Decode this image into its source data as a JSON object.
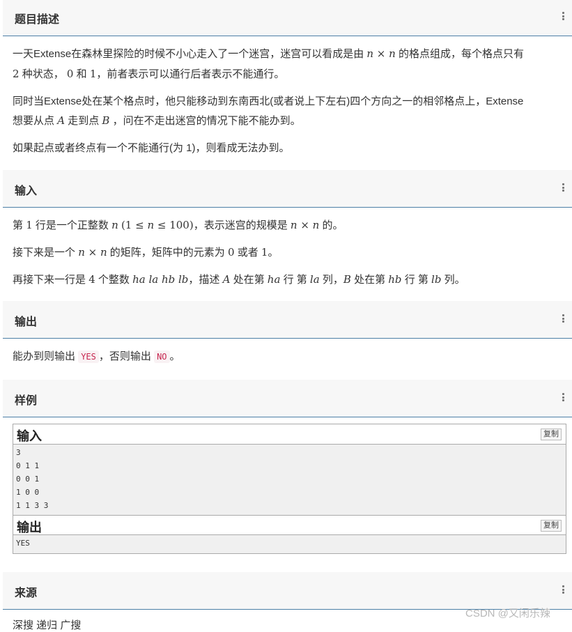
{
  "sections": {
    "description": {
      "title": "题目描述"
    },
    "input": {
      "title": "输入"
    },
    "output": {
      "title": "输出"
    },
    "sample": {
      "title": "样例"
    },
    "source": {
      "title": "来源"
    }
  },
  "description": {
    "p1_l1_a": "一天Extense在森林里探险的时候不小心走入了一个迷宫，迷宫可以看成是由",
    "p1_l1_b": "n × n",
    "p1_l1_c": "的格点组成，每个格点只有",
    "p1_l2_a": "2",
    "p1_l2_b": "种状态，",
    "p1_l2_c": "0",
    "p1_l2_d": "和",
    "p1_l2_e": "1",
    "p1_l2_f": "，前者表示可以通行后者表示不能通行。",
    "p2_l1": "同时当Extense处在某个格点时，他只能移动到东南西北(或者说上下左右)四个方向之一的相邻格点上，Extense",
    "p2_l2_a": "想要从点",
    "p2_l2_b": "A",
    "p2_l2_c": "走到点",
    "p2_l2_d": "B",
    "p2_l2_e": "，问在不走出迷宫的情况下能不能办到。",
    "p3": "如果起点或者终点有一个不能通行(为 1)，则看成无法办到。"
  },
  "input": {
    "l1_a": "第",
    "l1_b": "1",
    "l1_c": "行是一个正整数",
    "l1_d": "n",
    "l1_e": "(1 ≤ ",
    "l1_f": "n",
    "l1_g": " ≤ 100)",
    "l1_h": "，表示迷宫的规模是",
    "l1_i": "n × n",
    "l1_j": "的。",
    "l2_a": "接下来是一个",
    "l2_b": "n × n",
    "l2_c": "的矩阵，矩阵中的元素为",
    "l2_d": "0",
    "l2_e": "或者",
    "l2_f": "1",
    "l2_g": "。",
    "l3_a": "再接下来一行是",
    "l3_b": "4",
    "l3_c": "个整数",
    "l3_d": "ha la hb lb",
    "l3_e": "，描述",
    "l3_f": "A",
    "l3_g": "处在第",
    "l3_h": "ha",
    "l3_i": "行 第",
    "l3_j": "la",
    "l3_k": "列，",
    "l3_l": "B",
    "l3_m": "处在第",
    "l3_n": "hb",
    "l3_o": "行 第",
    "l3_p": "lb",
    "l3_q": "列。"
  },
  "output": {
    "a": "能办到则输出",
    "yes": "YES",
    "b": "，否则输出",
    "no": "NO",
    "c": "。"
  },
  "sample": {
    "input_label": "输入",
    "output_label": "输出",
    "copy_label": "复制",
    "input_lines": [
      "3",
      "0 1 1",
      "0 0 1",
      "1 0 0",
      "1 1 3 3"
    ],
    "output_lines": [
      "YES"
    ]
  },
  "source": {
    "text": "深搜 递归 广搜"
  },
  "watermark": "CSDN @又闲乐辣",
  "colors": {
    "accent": "#4c7fa6",
    "code_text": "#c7254e",
    "code_bg": "#f9f2f4"
  }
}
